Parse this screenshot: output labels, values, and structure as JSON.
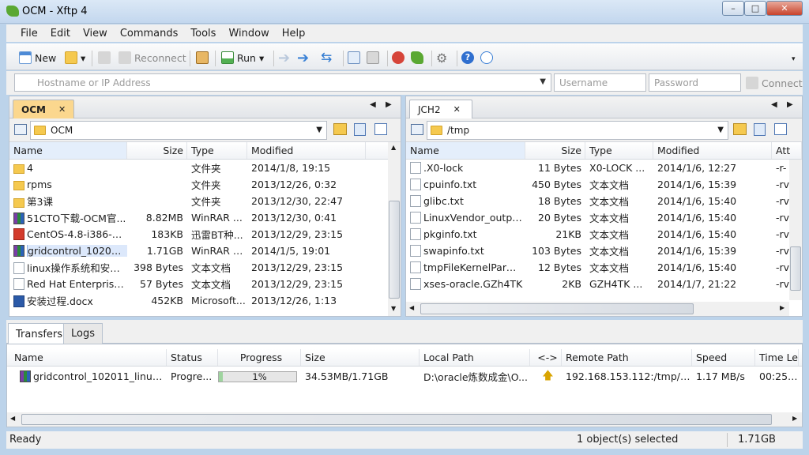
{
  "window": {
    "title": "OCM - Xftp 4"
  },
  "menu": [
    "File",
    "Edit",
    "View",
    "Commands",
    "Tools",
    "Window",
    "Help"
  ],
  "toolbar": {
    "new_label": "New",
    "reconnect_label": "Reconnect",
    "run_label": "Run"
  },
  "address": {
    "host_placeholder": "Hostname or IP Address",
    "username_placeholder": "Username",
    "password_placeholder": "Password",
    "connect_label": "Connect"
  },
  "left": {
    "tab": "OCM",
    "path": "OCM",
    "columns": [
      "Name",
      "Size",
      "Type",
      "Modified"
    ],
    "rows": [
      {
        "name": "4",
        "size": "",
        "type": "文件夹",
        "modified": "2014/1/8, 19:15",
        "icon": "folder-icon"
      },
      {
        "name": "rpms",
        "size": "",
        "type": "文件夹",
        "modified": "2013/12/26, 0:32",
        "icon": "folder-icon"
      },
      {
        "name": "第3课",
        "size": "",
        "type": "文件夹",
        "modified": "2013/12/30, 22:47",
        "icon": "folder-icon"
      },
      {
        "name": "51CTO下载-OCM官...",
        "size": "8.82MB",
        "type": "WinRAR ...",
        "modified": "2013/12/30, 0:41",
        "icon": "rar-archive-icon"
      },
      {
        "name": "CentOS-4.8-i386-bi...",
        "size": "183KB",
        "type": "迅雷BT种...",
        "modified": "2013/12/29, 23:15",
        "icon": "torrent-file-icon"
      },
      {
        "name": "gridcontrol_102011...",
        "size": "1.71GB",
        "type": "WinRAR Z...",
        "modified": "2014/1/5, 19:01",
        "icon": "rar-archive-icon",
        "selected": true
      },
      {
        "name": "linux操作系统和安装...",
        "size": "398 Bytes",
        "type": "文本文档",
        "modified": "2013/12/29, 23:15",
        "icon": "text-file-icon"
      },
      {
        "name": "Red Hat Enterprise ...",
        "size": "57 Bytes",
        "type": "文本文档",
        "modified": "2013/12/29, 23:15",
        "icon": "text-file-icon"
      },
      {
        "name": "安装过程.docx",
        "size": "452KB",
        "type": "Microsoft...",
        "modified": "2013/12/26, 1:13",
        "icon": "word-document-icon"
      }
    ]
  },
  "right": {
    "tab": "JCH2",
    "path": "/tmp",
    "columns": [
      "Name",
      "Size",
      "Type",
      "Modified",
      "Att"
    ],
    "rows": [
      {
        "name": ".X0-lock",
        "size": "11 Bytes",
        "type": "X0-LOCK ...",
        "modified": "2014/1/6, 12:27",
        "attr": "-r-"
      },
      {
        "name": "cpuinfo.txt",
        "size": "450 Bytes",
        "type": "文本文档",
        "modified": "2014/1/6, 15:39",
        "attr": "-rv"
      },
      {
        "name": "glibc.txt",
        "size": "18 Bytes",
        "type": "文本文档",
        "modified": "2014/1/6, 15:40",
        "attr": "-rv"
      },
      {
        "name": "LinuxVendor_output...",
        "size": "20 Bytes",
        "type": "文本文档",
        "modified": "2014/1/6, 15:40",
        "attr": "-rv"
      },
      {
        "name": "pkginfo.txt",
        "size": "21KB",
        "type": "文本文档",
        "modified": "2014/1/6, 15:40",
        "attr": "-rv"
      },
      {
        "name": "swapinfo.txt",
        "size": "103 Bytes",
        "type": "文本文档",
        "modified": "2014/1/6, 15:39",
        "attr": "-rv"
      },
      {
        "name": "tmpFileKernelParms...",
        "size": "12 Bytes",
        "type": "文本文档",
        "modified": "2014/1/6, 15:40",
        "attr": "-rv"
      },
      {
        "name": "xses-oracle.GZh4TK",
        "size": "2KB",
        "type": "GZH4TK ...",
        "modified": "2014/1/7, 21:22",
        "attr": "-rv"
      }
    ]
  },
  "bottom_tabs": [
    "Transfers",
    "Logs"
  ],
  "transfers": {
    "columns": [
      "Name",
      "Status",
      "Progress",
      "Size",
      "Local Path",
      "<->",
      "Remote Path",
      "Speed",
      "Time Le"
    ],
    "rows": [
      {
        "name": "gridcontrol_102011_linux....",
        "status": "Progre...",
        "progress_label": "1%",
        "progress": 0.01,
        "size": "34.53MB/1.71GB",
        "local": "D:\\oracle炼数成金\\O...",
        "remote": "192.168.153.112:/tmp/gr...",
        "speed": "1.17 MB/s",
        "time": "00:25:00"
      }
    ]
  },
  "status": {
    "left": "Ready",
    "selection": "1 object(s) selected",
    "size": "1.71GB"
  }
}
